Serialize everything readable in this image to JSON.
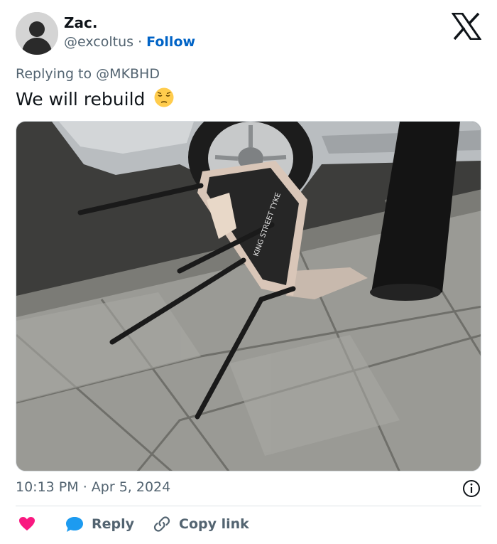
{
  "user": {
    "name": "Zac.",
    "handle": "@excoltus",
    "separator": "·",
    "follow_label": "Follow"
  },
  "reply": {
    "prefix": "Replying to",
    "mention": "@MKBHD"
  },
  "tweet": {
    "text": "We will rebuild",
    "emoji": "pensive-face"
  },
  "media": {
    "kind": "photo",
    "chair_writing": "KING STREET TYKE"
  },
  "meta": {
    "time": "10:13 PM",
    "separator": "·",
    "date": "Apr 5, 2024"
  },
  "actions": {
    "reply_label": "Reply",
    "copy_label": "Copy link"
  },
  "colors": {
    "accent": "#0063c6",
    "like": "#f91880",
    "reply": "#1d9bf0",
    "secondary": "#536471"
  },
  "icons": [
    "x-logo-icon",
    "info-icon",
    "heart-icon",
    "reply-bubble-icon",
    "link-icon"
  ]
}
